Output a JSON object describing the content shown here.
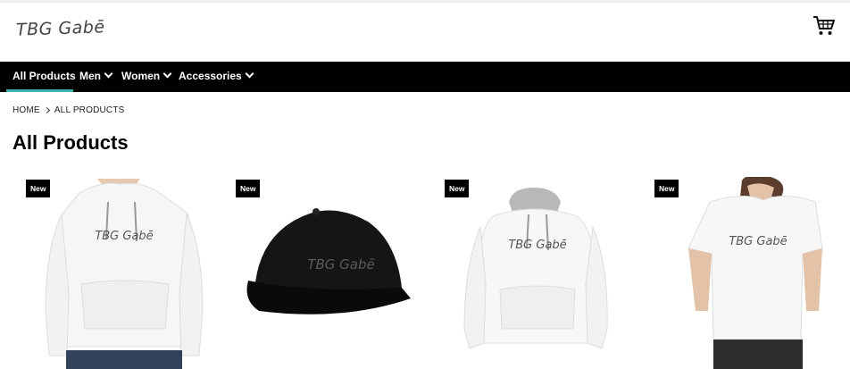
{
  "header": {
    "logo_text": "TBG Gabē",
    "cart_icon": "shopping-cart-icon"
  },
  "nav": {
    "items": [
      {
        "label": "All Products",
        "has_dropdown": false,
        "active": true
      },
      {
        "label": "Men",
        "has_dropdown": true
      },
      {
        "label": "Women",
        "has_dropdown": true
      },
      {
        "label": "Accessories",
        "has_dropdown": true
      }
    ]
  },
  "breadcrumb": {
    "home": "HOME",
    "current": "ALL PRODUCTS"
  },
  "page": {
    "title": "All Products"
  },
  "products": [
    {
      "badge": "New",
      "item": "women-hoodie-image",
      "print": "TBG Gabē"
    },
    {
      "badge": "New",
      "item": "snapback-cap-image",
      "print": "TBG Gabē"
    },
    {
      "badge": "New",
      "item": "contrast-hoodie-image",
      "print": "TBG Gabē"
    },
    {
      "badge": "New",
      "item": "women-tshirt-image",
      "print": "TBG Gabē"
    }
  ],
  "colors": {
    "nav_bg": "#000000",
    "nav_active": "#3fb3a9",
    "badge_bg": "#000000"
  }
}
